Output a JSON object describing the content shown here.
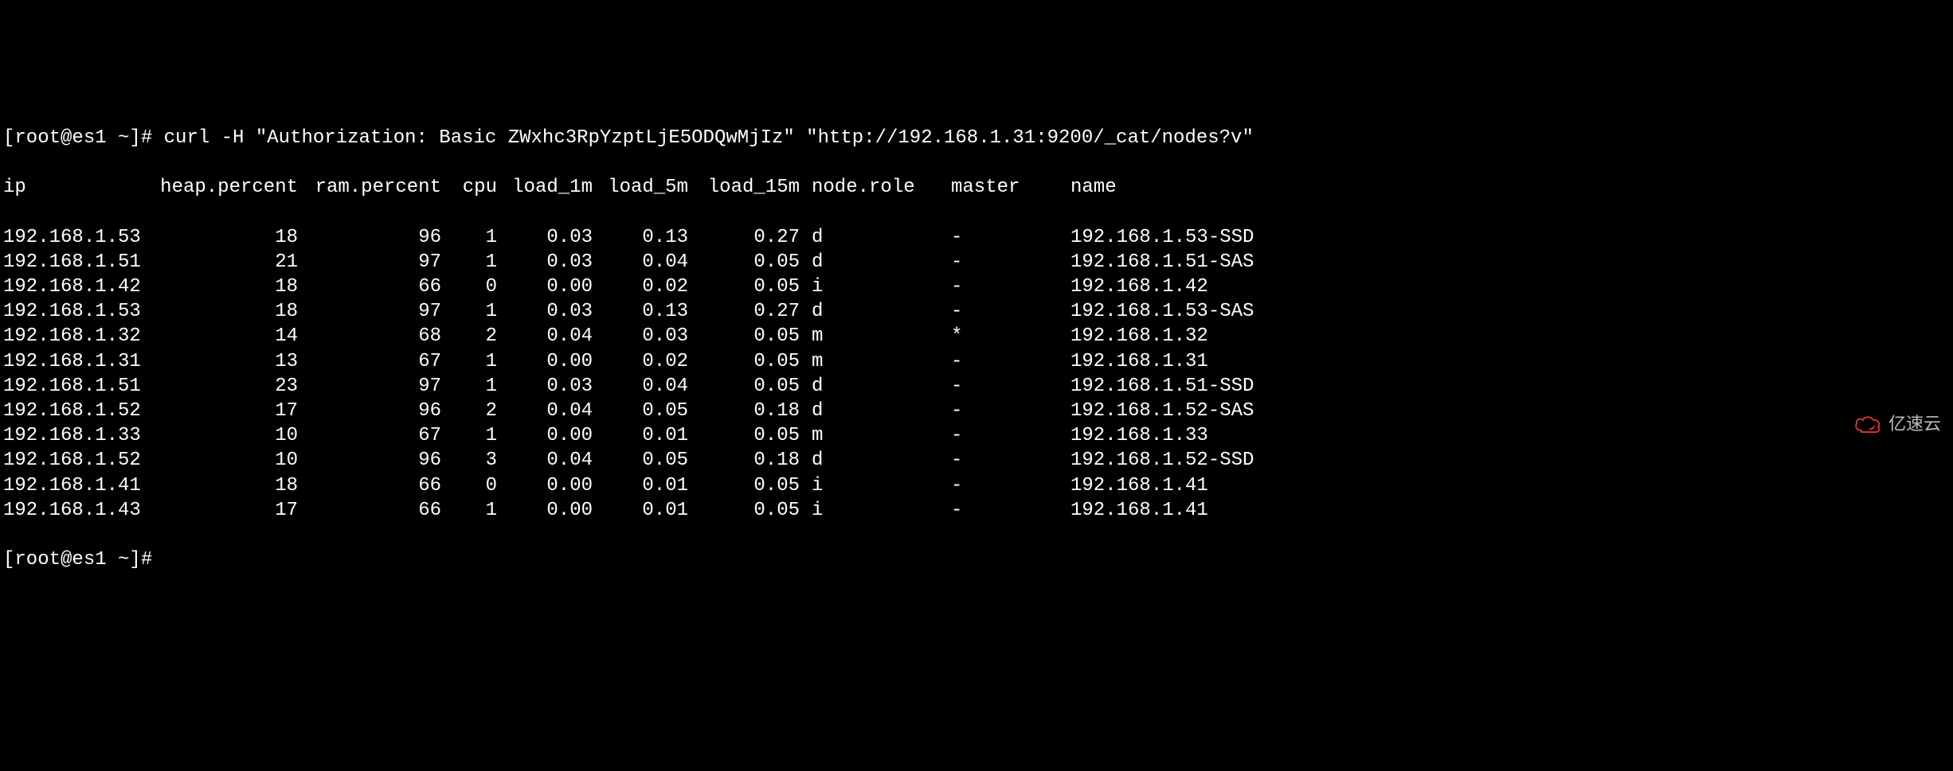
{
  "prompt": "[root@es1 ~]# ",
  "command": "curl -H \"Authorization: Basic ZWxhc3RpYzptLjE5ODQwMjIz\" \"http://192.168.1.31:9200/_cat/nodes?v\"",
  "headers": {
    "ip": "ip",
    "heap": "heap.percent",
    "ram": "ram.percent",
    "cpu": "cpu",
    "l1": "load_1m",
    "l5": "load_5m",
    "l15": "load_15m",
    "role": "node.role",
    "master": "master",
    "name": "name"
  },
  "rows": [
    {
      "ip": "192.168.1.53",
      "heap": "18",
      "ram": "96",
      "cpu": "1",
      "l1": "0.03",
      "l5": "0.13",
      "l15": "0.27",
      "role": "d",
      "master": "-",
      "name": "192.168.1.53-SSD"
    },
    {
      "ip": "192.168.1.51",
      "heap": "21",
      "ram": "97",
      "cpu": "1",
      "l1": "0.03",
      "l5": "0.04",
      "l15": "0.05",
      "role": "d",
      "master": "-",
      "name": "192.168.1.51-SAS"
    },
    {
      "ip": "192.168.1.42",
      "heap": "18",
      "ram": "66",
      "cpu": "0",
      "l1": "0.00",
      "l5": "0.02",
      "l15": "0.05",
      "role": "i",
      "master": "-",
      "name": "192.168.1.42"
    },
    {
      "ip": "192.168.1.53",
      "heap": "18",
      "ram": "97",
      "cpu": "1",
      "l1": "0.03",
      "l5": "0.13",
      "l15": "0.27",
      "role": "d",
      "master": "-",
      "name": "192.168.1.53-SAS"
    },
    {
      "ip": "192.168.1.32",
      "heap": "14",
      "ram": "68",
      "cpu": "2",
      "l1": "0.04",
      "l5": "0.03",
      "l15": "0.05",
      "role": "m",
      "master": "*",
      "name": "192.168.1.32"
    },
    {
      "ip": "192.168.1.31",
      "heap": "13",
      "ram": "67",
      "cpu": "1",
      "l1": "0.00",
      "l5": "0.02",
      "l15": "0.05",
      "role": "m",
      "master": "-",
      "name": "192.168.1.31"
    },
    {
      "ip": "192.168.1.51",
      "heap": "23",
      "ram": "97",
      "cpu": "1",
      "l1": "0.03",
      "l5": "0.04",
      "l15": "0.05",
      "role": "d",
      "master": "-",
      "name": "192.168.1.51-SSD"
    },
    {
      "ip": "192.168.1.52",
      "heap": "17",
      "ram": "96",
      "cpu": "2",
      "l1": "0.04",
      "l5": "0.05",
      "l15": "0.18",
      "role": "d",
      "master": "-",
      "name": "192.168.1.52-SAS"
    },
    {
      "ip": "192.168.1.33",
      "heap": "10",
      "ram": "67",
      "cpu": "1",
      "l1": "0.00",
      "l5": "0.01",
      "l15": "0.05",
      "role": "m",
      "master": "-",
      "name": "192.168.1.33"
    },
    {
      "ip": "192.168.1.52",
      "heap": "10",
      "ram": "96",
      "cpu": "3",
      "l1": "0.04",
      "l5": "0.05",
      "l15": "0.18",
      "role": "d",
      "master": "-",
      "name": "192.168.1.52-SSD"
    },
    {
      "ip": "192.168.1.41",
      "heap": "18",
      "ram": "66",
      "cpu": "0",
      "l1": "0.00",
      "l5": "0.01",
      "l15": "0.05",
      "role": "i",
      "master": "-",
      "name": "192.168.1.41"
    },
    {
      "ip": "192.168.1.43",
      "heap": "17",
      "ram": "66",
      "cpu": "1",
      "l1": "0.00",
      "l5": "0.01",
      "l15": "0.05",
      "role": "i",
      "master": "-",
      "name": "192.168.1.41"
    }
  ],
  "prompt2": "[root@es1 ~]#",
  "watermark": "亿速云"
}
